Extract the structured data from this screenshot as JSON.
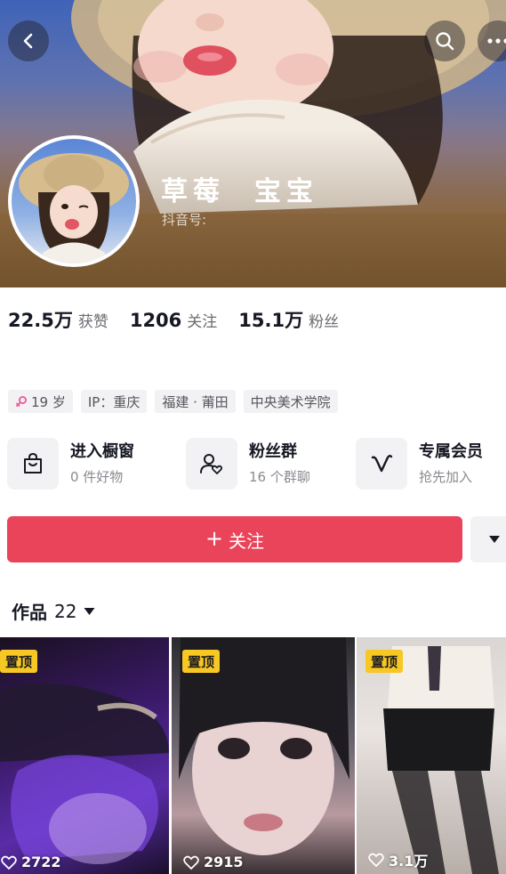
{
  "profile": {
    "name": "草莓  宝宝",
    "douyin_id_label": "抖音号:"
  },
  "stats": [
    {
      "value": "22.5万",
      "label": "获赞"
    },
    {
      "value": "1206",
      "label": "关注"
    },
    {
      "value": "15.1万",
      "label": "粉丝"
    }
  ],
  "tags": [
    {
      "icon": "female-icon",
      "text": "19 岁"
    },
    {
      "text": "IP：重庆"
    },
    {
      "text": "福建 · 莆田"
    },
    {
      "text": "中央美术学院"
    }
  ],
  "entries": {
    "shop": {
      "title": "进入橱窗",
      "sub": "0 件好物",
      "icon": "shopping-bag-icon"
    },
    "fans": {
      "title": "粉丝群",
      "sub": "16 个群聊",
      "icon": "fan-group-icon"
    },
    "vip": {
      "title": "专属会员",
      "sub": "抢先加入",
      "icon": "vip-icon"
    }
  },
  "follow": {
    "plus": "+",
    "label": "关注"
  },
  "works": {
    "title": "作品",
    "count": "22"
  },
  "videos": [
    {
      "pinned_label": "置顶",
      "likes": "2722"
    },
    {
      "pinned_label": "置顶",
      "likes": "2915"
    },
    {
      "pinned_label": "置顶",
      "likes": "3.1万"
    }
  ],
  "colors": {
    "accent": "#ea445a",
    "pin_badge": "#f7c724",
    "text_primary": "#161823",
    "text_secondary": "#8a8b91"
  }
}
